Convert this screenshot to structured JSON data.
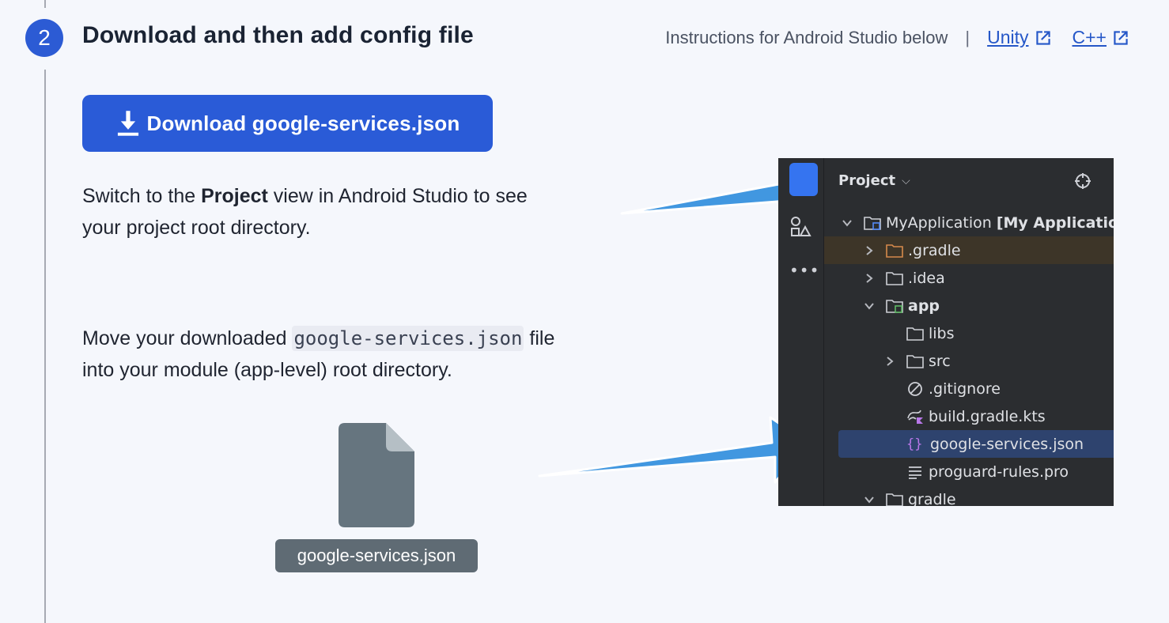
{
  "step": {
    "number": "2",
    "title": "Download and then add config file"
  },
  "instructions": {
    "text": "Instructions for Android Studio below",
    "separator": "|",
    "links": [
      {
        "label": "Unity"
      },
      {
        "label": "C++"
      }
    ]
  },
  "download_button": {
    "label": "Download google-services.json"
  },
  "paragraph1": {
    "part1": "Switch to the ",
    "bold": "Project",
    "part2": " view in Android Studio to see",
    "line2": "your project root directory."
  },
  "paragraph2": {
    "part1": "Move your downloaded ",
    "code": "google-services.json",
    "part2": " file",
    "line2": "into your module (app-level) root directory."
  },
  "file_chip": {
    "label": "google-services.json"
  },
  "ide": {
    "header": "Project",
    "tree": [
      {
        "label": "MyApplication",
        "suffix": "[My Application]"
      },
      {
        "label": ".gradle"
      },
      {
        "label": ".idea"
      },
      {
        "label": "app"
      },
      {
        "label": "libs"
      },
      {
        "label": "src"
      },
      {
        "label": ".gitignore"
      },
      {
        "label": "build.gradle.kts"
      },
      {
        "label": "google-services.json"
      },
      {
        "label": "proguard-rules.pro"
      },
      {
        "label": "gradle"
      }
    ]
  },
  "colors": {
    "accent": "#2a5bd7",
    "arrow": "#4197e0",
    "ide_bg": "#2b2d30",
    "selected_row": "#2e436e"
  }
}
